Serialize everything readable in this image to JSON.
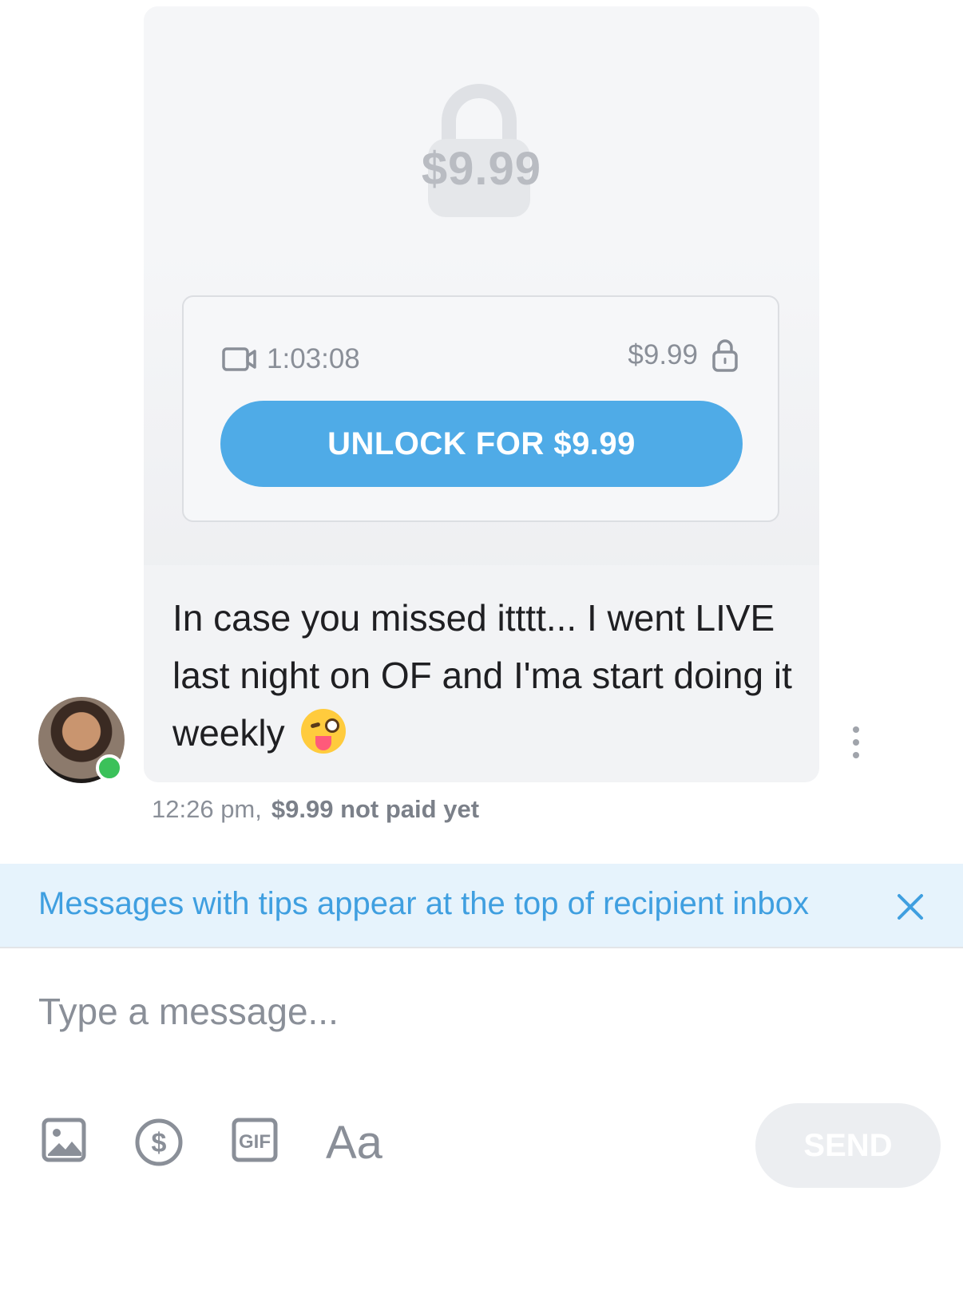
{
  "message": {
    "media": {
      "locked_price": "$9.99",
      "duration": "1:03:08",
      "price": "$9.99",
      "unlock_label": "UNLOCK FOR $9.99",
      "icons": {
        "lock": "lock-icon",
        "video": "video-camera-icon"
      }
    },
    "text": "In case you missed itttt... I went LIVE last night on OF and I'ma start doing it weekly",
    "emoji": "winking-face-with-tongue",
    "time": "12:26 pm,",
    "payment_status": "$9.99 not paid yet",
    "sender_online": true
  },
  "tip_banner": {
    "text": "Messages with tips appear at the top of recipient inbox"
  },
  "composer": {
    "placeholder": "Type a message...",
    "font_label": "Aa",
    "send_label": "SEND"
  },
  "colors": {
    "accent": "#4fabe7",
    "banner_bg": "#e6f3fc",
    "banner_text": "#3f9fe0",
    "online": "#3bc15a"
  }
}
